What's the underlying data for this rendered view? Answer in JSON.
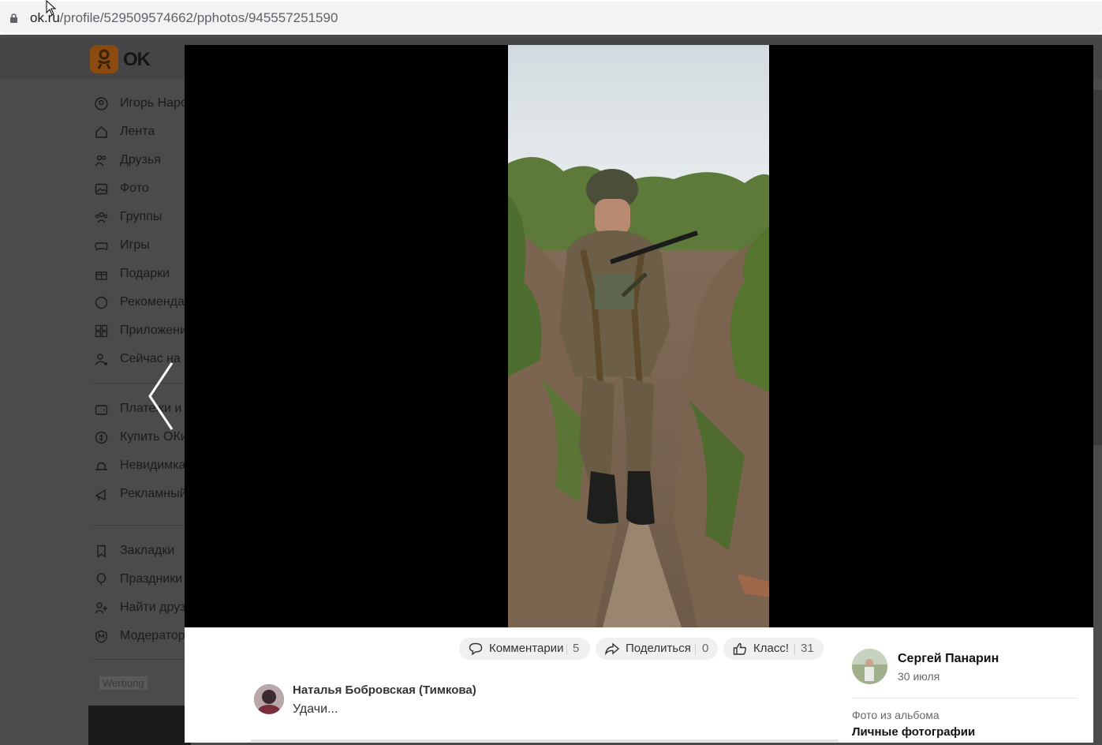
{
  "browser": {
    "url_domain": "ok.ru",
    "url_path": "/profile/529509574662/pphotos/945557251590"
  },
  "site": {
    "logo_text": "OK",
    "menu": [
      {
        "label": "Игорь Наро",
        "icon": "user-icon"
      },
      {
        "label": "Лента",
        "icon": "home-icon"
      },
      {
        "label": "Друзья",
        "icon": "friends-icon"
      },
      {
        "label": "Фото",
        "icon": "photo-icon"
      },
      {
        "label": "Группы",
        "icon": "groups-icon"
      },
      {
        "label": "Игры",
        "icon": "gamepad-icon"
      },
      {
        "label": "Подарки",
        "icon": "gift-icon"
      },
      {
        "label": "Рекоменда",
        "icon": "compass-icon"
      },
      {
        "label": "Приложени",
        "icon": "apps-icon"
      },
      {
        "label": "Сейчас на с",
        "icon": "user-online-icon"
      }
    ],
    "menu2": [
      {
        "label": "Платежи и",
        "icon": "wallet-icon"
      },
      {
        "label": "Купить ОКи",
        "icon": "coin-icon"
      },
      {
        "label": "Невидимка",
        "icon": "hat-icon"
      },
      {
        "label": "Рекламный",
        "icon": "megaphone-icon"
      }
    ],
    "menu3": [
      {
        "label": "Закладки",
        "icon": "bookmark-icon"
      },
      {
        "label": "Праздники",
        "icon": "balloon-icon"
      },
      {
        "label": "Найти друз",
        "icon": "add-friend-icon"
      },
      {
        "label": "Модератор",
        "icon": "moderator-icon"
      }
    ],
    "ad_label": "Werbung"
  },
  "viewer": {
    "actions": {
      "comments_label": "Комментарии",
      "comments_count": "5",
      "share_label": "Поделиться",
      "share_count": "0",
      "like_label": "Класс!",
      "like_count": "31"
    },
    "comment": {
      "author": "Наталья Бобровская (Тимкова)",
      "text": "Удачи..."
    },
    "owner": {
      "name": "Сергей Панарин",
      "date": "30 июля",
      "album_caption": "Фото из альбома",
      "album_name": "Личные фотографии"
    }
  },
  "colors": {
    "brand_orange": "#ee8208",
    "viewer_bg": "#000000",
    "pill_bg": "#f0f0f0"
  }
}
